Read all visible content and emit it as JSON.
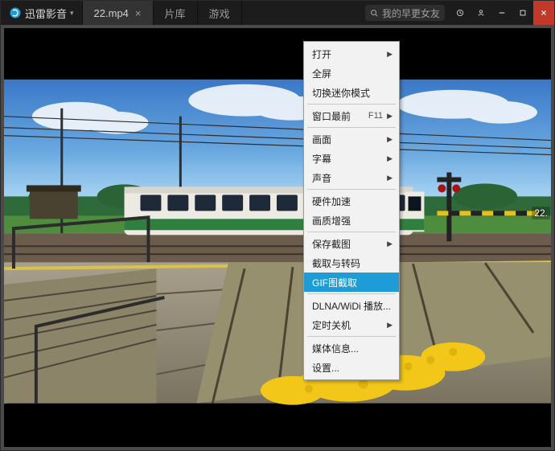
{
  "app": {
    "name": "迅雷影音"
  },
  "tabs": [
    {
      "label": "22.mp4",
      "active": true
    },
    {
      "label": "片库",
      "active": false
    },
    {
      "label": "游戏",
      "active": false
    }
  ],
  "search": {
    "placeholder": "我的早更女友"
  },
  "video": {
    "time_badge": "22."
  },
  "context_menu": {
    "items": [
      {
        "label": "打开",
        "submenu": true
      },
      {
        "label": "全屏"
      },
      {
        "label": "切换迷你模式"
      },
      {
        "sep": true
      },
      {
        "label": "窗口最前",
        "hotkey": "F11",
        "submenu": true
      },
      {
        "sep": true
      },
      {
        "label": "画面",
        "submenu": true
      },
      {
        "label": "字幕",
        "submenu": true
      },
      {
        "label": "声音",
        "submenu": true
      },
      {
        "sep": true
      },
      {
        "label": "硬件加速"
      },
      {
        "label": "画质增强"
      },
      {
        "sep": true
      },
      {
        "label": "保存截图",
        "submenu": true
      },
      {
        "label": "截取与转码"
      },
      {
        "label": "GIF图截取",
        "selected": true
      },
      {
        "sep": true
      },
      {
        "label": "DLNA/WiDi 播放..."
      },
      {
        "label": "定时关机",
        "submenu": true
      },
      {
        "sep": true
      },
      {
        "label": "媒体信息..."
      },
      {
        "label": "设置..."
      }
    ]
  }
}
